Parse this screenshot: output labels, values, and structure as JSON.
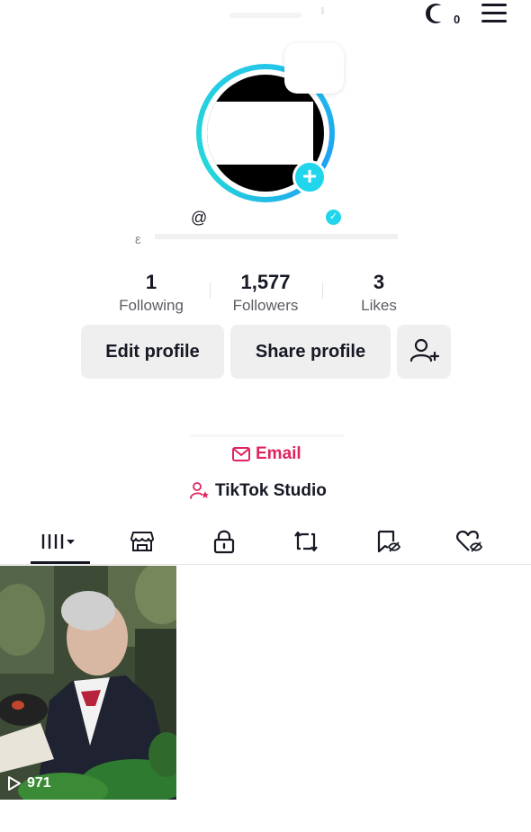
{
  "header": {
    "notification_count": "0"
  },
  "profile": {
    "at_symbol": "@",
    "bio_icon": "link-icon",
    "verified": true
  },
  "stats": [
    {
      "value": "1",
      "label": "Following"
    },
    {
      "value": "1,577",
      "label": "Followers"
    },
    {
      "value": "3",
      "label": "Likes"
    }
  ],
  "actions": {
    "edit_profile": "Edit profile",
    "share_profile": "Share profile",
    "add_friend_icon": "add-person-icon"
  },
  "links": {
    "email": "Email",
    "studio": "TikTok Studio"
  },
  "tabs": [
    {
      "icon": "grid-icon",
      "selected": true
    },
    {
      "icon": "shop-icon",
      "selected": false
    },
    {
      "icon": "lock-icon",
      "selected": false
    },
    {
      "icon": "repost-icon",
      "selected": false
    },
    {
      "icon": "bookmark-icon",
      "selected": false
    },
    {
      "icon": "liked-icon",
      "selected": false
    }
  ],
  "videos": [
    {
      "views": "971"
    }
  ],
  "colors": {
    "accent_pink": "#e0245e",
    "ring_cyan": "#20d5ec",
    "text_primary": "#161823",
    "button_bg": "#efefef"
  }
}
